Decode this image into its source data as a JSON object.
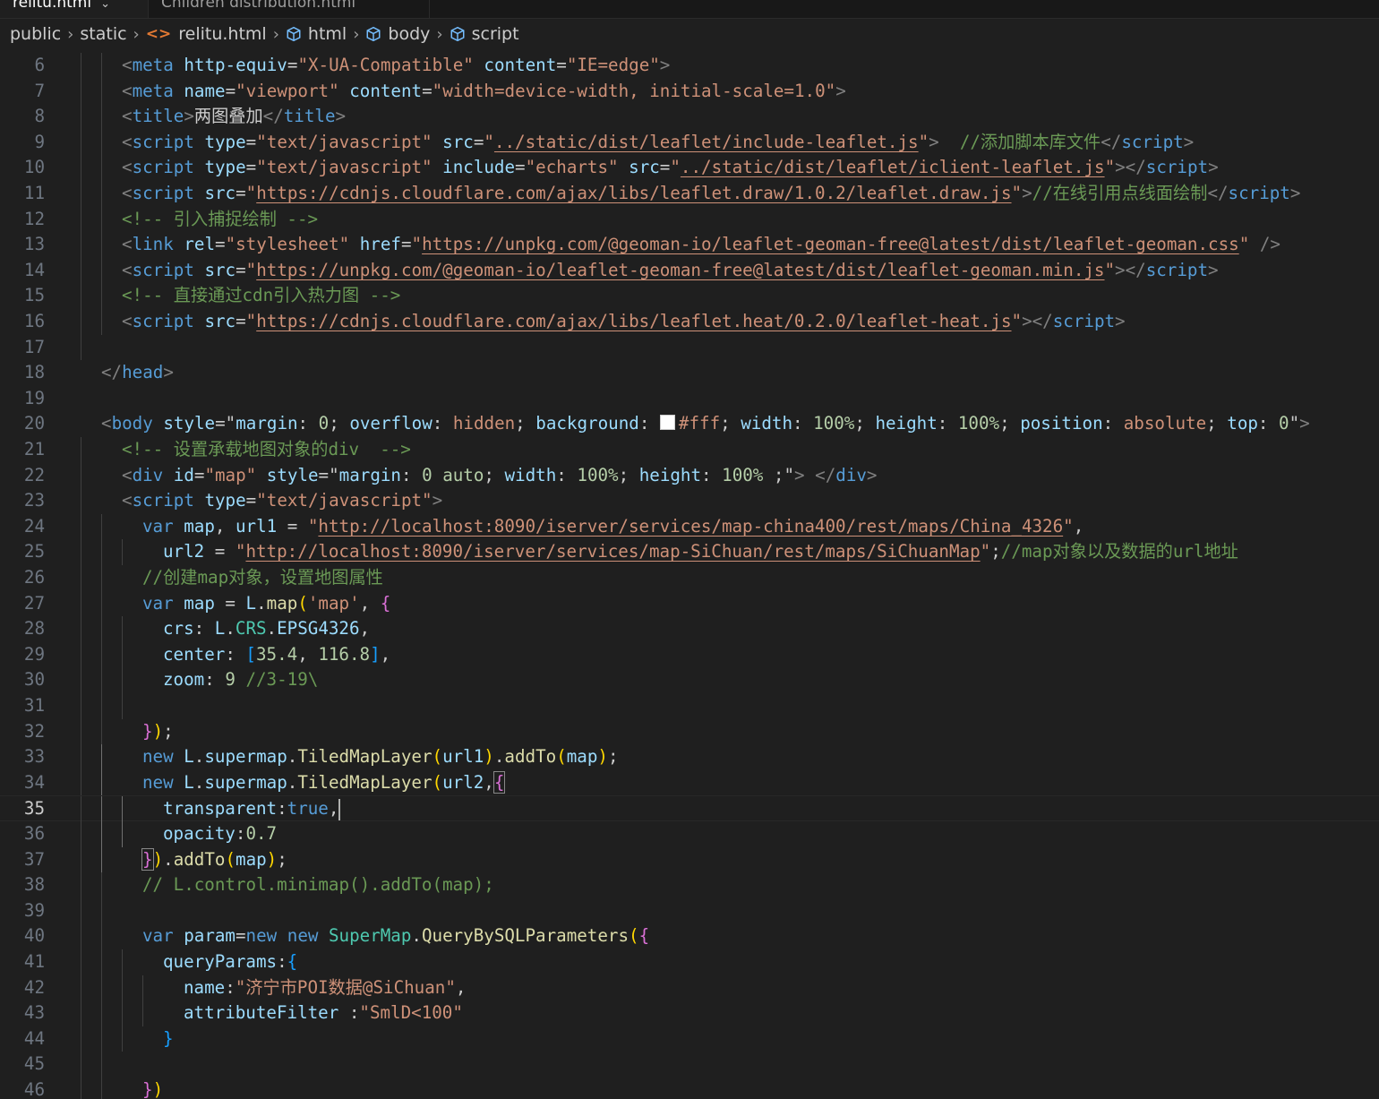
{
  "tabs": [
    {
      "label": "relitu.html",
      "active": true
    },
    {
      "label": "Children distribution.html",
      "active": false
    }
  ],
  "breadcrumb": {
    "items": [
      "public",
      "static",
      "relitu.html",
      "html",
      "body",
      "script"
    ],
    "icons": [
      "",
      "",
      "html-file-icon",
      "symbol-element-icon",
      "symbol-element-icon",
      "symbol-element-icon"
    ]
  },
  "editor": {
    "current_line": "35",
    "lines": [
      {
        "n": "6"
      },
      {
        "n": "7"
      },
      {
        "n": "8"
      },
      {
        "n": "9"
      },
      {
        "n": "10"
      },
      {
        "n": "11"
      },
      {
        "n": "12"
      },
      {
        "n": "13"
      },
      {
        "n": "14"
      },
      {
        "n": "15"
      },
      {
        "n": "16"
      },
      {
        "n": "17"
      },
      {
        "n": "18"
      },
      {
        "n": "19"
      },
      {
        "n": "20"
      },
      {
        "n": "21"
      },
      {
        "n": "22"
      },
      {
        "n": "23"
      },
      {
        "n": "24"
      },
      {
        "n": "25"
      },
      {
        "n": "26"
      },
      {
        "n": "27"
      },
      {
        "n": "28"
      },
      {
        "n": "29"
      },
      {
        "n": "30"
      },
      {
        "n": "31"
      },
      {
        "n": "32"
      },
      {
        "n": "33"
      },
      {
        "n": "34"
      },
      {
        "n": "35"
      },
      {
        "n": "36"
      },
      {
        "n": "37"
      },
      {
        "n": "38"
      },
      {
        "n": "39"
      },
      {
        "n": "40"
      },
      {
        "n": "41"
      },
      {
        "n": "42"
      },
      {
        "n": "43"
      },
      {
        "n": "44"
      },
      {
        "n": "45"
      },
      {
        "n": "46"
      }
    ],
    "code": {
      "l6": [
        "<",
        "meta",
        " ",
        "http-equiv",
        "=",
        "\"X-UA-Compatible\"",
        " ",
        "content",
        "=",
        "\"IE=edge\"",
        ">"
      ],
      "l7": [
        "<",
        "meta",
        " ",
        "name",
        "=",
        "\"viewport\"",
        " ",
        "content",
        "=",
        "\"width=device-width, initial-scale=1.0\"",
        ">"
      ],
      "l8": [
        "<",
        "title",
        ">",
        "两图叠加",
        "</",
        "title",
        ">"
      ],
      "l9": [
        "<",
        "script",
        " ",
        "type",
        "=",
        "\"text/javascript\"",
        " ",
        "src",
        "=",
        "\"",
        "../static/dist/leaflet/include-leaflet.js",
        "\"",
        ">",
        "  //添加脚本库文件",
        "</",
        "script",
        ">"
      ],
      "l10": [
        "<",
        "script",
        " ",
        "type",
        "=",
        "\"text/javascript\"",
        " ",
        "include",
        "=",
        "\"echarts\"",
        " ",
        "src",
        "=",
        "\"",
        "../static/dist/leaflet/iclient-leaflet.js",
        "\"",
        "></",
        "script",
        ">"
      ],
      "l11": [
        "<",
        "script",
        " ",
        "src",
        "=",
        "\"",
        "https://cdnjs.cloudflare.com/ajax/libs/leaflet.draw/1.0.2/leaflet.draw.js",
        "\"",
        ">",
        "//在线引用点线面绘制",
        "</",
        "script",
        ">"
      ],
      "l12": [
        "<!-- 引入捕捉绘制 -->"
      ],
      "l13": [
        "<",
        "link",
        " ",
        "rel",
        "=",
        "\"stylesheet\"",
        " ",
        "href",
        "=",
        "\"",
        "https://unpkg.com/@geoman-io/leaflet-geoman-free@latest/dist/leaflet-geoman.css",
        "\"",
        " />"
      ],
      "l14": [
        "<",
        "script",
        " ",
        "src",
        "=",
        "\"",
        "https://unpkg.com/@geoman-io/leaflet-geoman-free@latest/dist/leaflet-geoman.min.js",
        "\"",
        "></",
        "script",
        ">"
      ],
      "l15": [
        "<!-- 直接通过cdn引入热力图 -->"
      ],
      "l16": [
        "<",
        "script",
        " ",
        "src",
        "=",
        "\"",
        "https://cdnjs.cloudflare.com/ajax/libs/leaflet.heat/0.2.0/leaflet-heat.js",
        "\"",
        "></",
        "script",
        ">"
      ],
      "l18": [
        "</",
        "head",
        ">"
      ],
      "l20": [
        "<",
        "body",
        " ",
        "style",
        "=",
        "\"",
        "margin",
        ": ",
        "0",
        "; ",
        "overflow",
        ": ",
        "hidden",
        "; ",
        "background",
        ": ",
        "#fff",
        "; ",
        "width",
        ": ",
        "100%",
        "; ",
        "height",
        ": ",
        "100%",
        "; ",
        "position",
        ": ",
        "absolute",
        "; ",
        "top",
        ": ",
        "0",
        "\"",
        ">"
      ],
      "l21": [
        "<!-- 设置承载地图对象的div  -->"
      ],
      "l22": [
        "<",
        "div",
        " ",
        "id",
        "=",
        "\"map\"",
        " ",
        "style",
        "=",
        "\"",
        "margin",
        ": ",
        "0 auto",
        "; ",
        "width",
        ": ",
        "100%",
        "; ",
        "height",
        ": ",
        "100%",
        " ;",
        "\"",
        ">",
        " ",
        "</",
        "div",
        ">"
      ],
      "l23": [
        "<",
        "script",
        " ",
        "type",
        "=",
        "\"text/javascript\"",
        ">"
      ],
      "l24": [
        "var",
        " ",
        "map",
        ", ",
        "url1",
        " = ",
        "\"",
        "http://localhost:8090/iserver/services/map-china400/rest/maps/China_4326",
        "\"",
        ","
      ],
      "l25": [
        "url2",
        " = ",
        "\"",
        "http://localhost:8090/iserver/services/map-SiChuan/rest/maps/SiChuanMap",
        "\"",
        ";",
        "//map对象以及数据的url地址"
      ],
      "l26": [
        "//创建map对象，设置地图属性"
      ],
      "l27": [
        "var",
        " ",
        "map",
        " = ",
        "L",
        ".",
        "map",
        "(",
        "'map'",
        ", ",
        "{"
      ],
      "l28": [
        "crs",
        ": ",
        "L",
        ".",
        "CRS",
        ".",
        "EPSG4326",
        ","
      ],
      "l29": [
        "center",
        ": ",
        "[",
        "35.4",
        ", ",
        "116.8",
        "]",
        ","
      ],
      "l30": [
        "zoom",
        ": ",
        "9",
        " ",
        "//3-19\\"
      ],
      "l32": [
        "}",
        ")",
        ";"
      ],
      "l33": [
        "new",
        " ",
        "L",
        ".",
        "supermap",
        ".",
        "TiledMapLayer",
        "(",
        "url1",
        ")",
        ".",
        "addTo",
        "(",
        "map",
        ")",
        ";"
      ],
      "l34": [
        "new",
        " ",
        "L",
        ".",
        "supermap",
        ".",
        "TiledMapLayer",
        "(",
        "url2",
        ",",
        "{"
      ],
      "l35": [
        "transparent",
        ":",
        "true",
        ","
      ],
      "l36": [
        "opacity",
        ":",
        "0.7"
      ],
      "l37": [
        "}",
        ")",
        ".",
        "addTo",
        "(",
        "map",
        ")",
        ";"
      ],
      "l38": [
        "// L.control.minimap().addTo(map);"
      ],
      "l40": [
        "var",
        " ",
        "param",
        "=",
        "new",
        " ",
        "new",
        " ",
        "SuperMap",
        ".",
        "QueryBySQLParameters",
        "(",
        "{"
      ],
      "l41": [
        "queryParams",
        ":",
        "{"
      ],
      "l42": [
        "name",
        ":",
        "\"济宁市POI数据@SiChuan\"",
        ","
      ],
      "l43": [
        "attributeFilter",
        " :",
        "\"SmlD<100\""
      ],
      "l44": [
        "}"
      ],
      "l46": [
        "}",
        ")"
      ]
    }
  },
  "colors": {
    "background": "#1f1f1f",
    "tag": "#569cd6",
    "attribute": "#9cdcfe",
    "string": "#ce9178",
    "comment": "#6a9955",
    "function": "#dcdcaa",
    "class": "#4ec9b0",
    "number": "#b5cea8",
    "bracket_gold": "#ffd700",
    "bracket_orchid": "#da70d6",
    "bracket_blue": "#179fff"
  }
}
